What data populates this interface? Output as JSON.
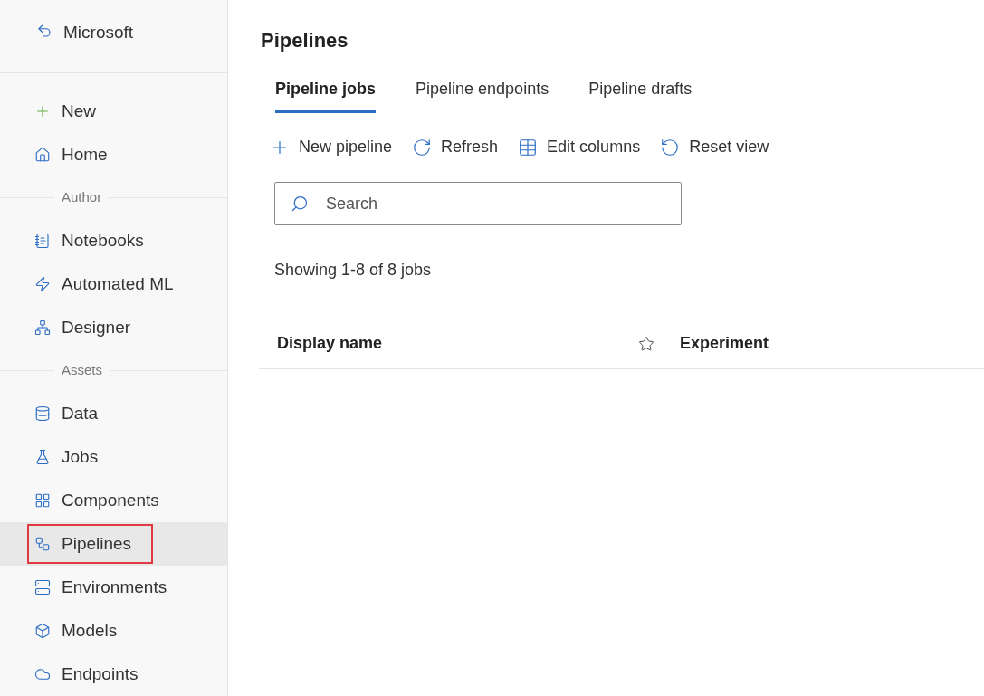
{
  "sidebar": {
    "back_label": "Microsoft",
    "items": [
      {
        "kind": "item",
        "label": "New",
        "selected": false,
        "highlighted": false
      },
      {
        "kind": "item",
        "label": "Home",
        "selected": false,
        "highlighted": false
      },
      {
        "kind": "section",
        "label": "Author"
      },
      {
        "kind": "item",
        "label": "Notebooks",
        "selected": false,
        "highlighted": false
      },
      {
        "kind": "item",
        "label": "Automated ML",
        "selected": false,
        "highlighted": false
      },
      {
        "kind": "item",
        "label": "Designer",
        "selected": false,
        "highlighted": false
      },
      {
        "kind": "section",
        "label": "Assets"
      },
      {
        "kind": "item",
        "label": "Data",
        "selected": false,
        "highlighted": false
      },
      {
        "kind": "item",
        "label": "Jobs",
        "selected": false,
        "highlighted": false
      },
      {
        "kind": "item",
        "label": "Components",
        "selected": false,
        "highlighted": false
      },
      {
        "kind": "item",
        "label": "Pipelines",
        "selected": true,
        "highlighted": true
      },
      {
        "kind": "item",
        "label": "Environments",
        "selected": false,
        "highlighted": false
      },
      {
        "kind": "item",
        "label": "Models",
        "selected": false,
        "highlighted": false
      },
      {
        "kind": "item",
        "label": "Endpoints",
        "selected": false,
        "highlighted": false
      }
    ]
  },
  "page_title": "Pipelines",
  "tabs": [
    {
      "label": "Pipeline jobs",
      "selected": true
    },
    {
      "label": "Pipeline endpoints",
      "selected": false
    },
    {
      "label": "Pipeline drafts",
      "selected": false
    }
  ],
  "toolbar": [
    "New pipeline",
    "Refresh",
    "Edit columns",
    "Reset view"
  ],
  "search": {
    "placeholder": "Search"
  },
  "count_text": "Showing 1-8 of 8 jobs",
  "table": {
    "columns": [
      {
        "kind": "text",
        "label": "Display name"
      },
      {
        "kind": "star"
      },
      {
        "kind": "text",
        "label": "Experiment"
      }
    ]
  }
}
